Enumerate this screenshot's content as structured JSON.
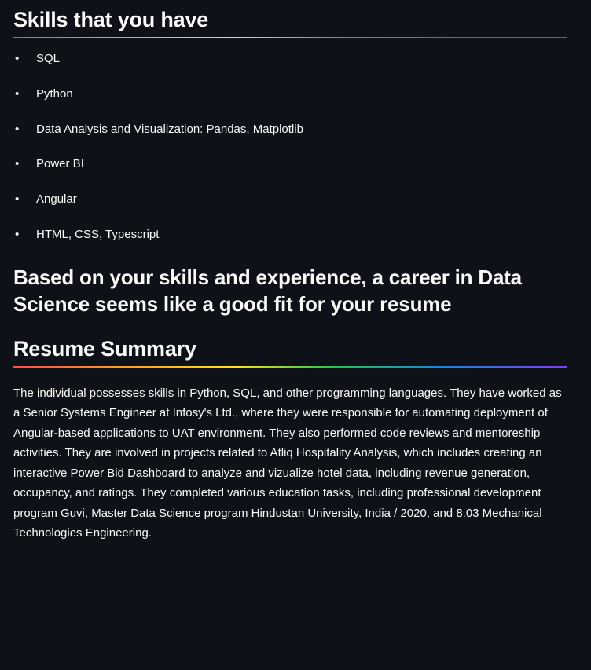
{
  "skills_section": {
    "title": "Skills that you have",
    "items": [
      "SQL",
      "Python",
      "Data Analysis and Visualization: Pandas, Matplotlib",
      "Power BI",
      "Angular",
      "HTML, CSS, Typescript"
    ]
  },
  "career": {
    "message": "Based on your skills and experience, a career in Data Science seems like a good fit for your resume"
  },
  "summary_section": {
    "title": "Resume Summary",
    "text": "The individual possesses skills in Python, SQL, and other programming languages. They have worked as a Senior Systems Engineer at Infosy's Ltd., where they were responsible for automating deployment of Angular-based applications to UAT environment. They also performed code reviews and mentoreship activities. They are involved in projects related to Atliq Hospitality Analysis, which includes creating an interactive Power Bid Dashboard to analyze and vizualize hotel data, including revenue generation, occupancy, and ratings. They completed various education tasks, including professional development program Guvi, Master Data Science program Hindustan University, India / 2020, and 8.03 Mechanical Technologies Engineering."
  },
  "colors": {
    "background": "#0e1117",
    "text": "#fafafa",
    "divider_gradient": [
      "#ff4b4b",
      "#ffa421",
      "#ffe312",
      "#21c354",
      "#1c83e1",
      "#803df5"
    ]
  }
}
